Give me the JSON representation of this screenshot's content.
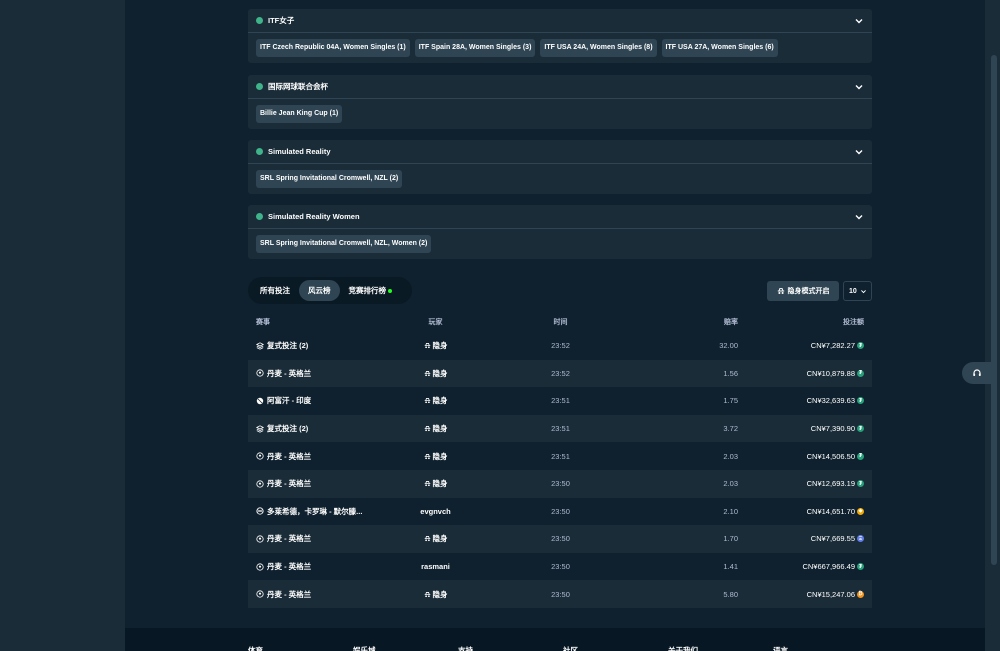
{
  "sections": [
    {
      "title": "ITF女子",
      "chips": [
        "ITF Czech Republic 04A, Women Singles (1)",
        "ITF Spain 28A, Women Singles (3)",
        "ITF USA 24A, Women Singles (8)",
        "ITF USA 27A, Women Singles (6)"
      ]
    },
    {
      "title": "国际网球联合会杯",
      "chips": [
        "Billie Jean King Cup (1)"
      ]
    },
    {
      "title": "Simulated Reality",
      "chips": [
        "SRL Spring Invitational Cromwell, NZL (2)"
      ]
    },
    {
      "title": "Simulated Reality Women",
      "chips": [
        "SRL Spring Invitational Cromwell, NZL, Women (2)"
      ]
    }
  ],
  "tabs": {
    "all_bets": "所有投注",
    "high_rollers": "风云榜",
    "race_leaderboard": "竞赛排行榜"
  },
  "stealth_label": "隐身模式开启",
  "page_size": "10",
  "table": {
    "headers": {
      "event": "赛事",
      "player": "玩家",
      "time": "时间",
      "odds": "赔率",
      "amount": "投注额"
    },
    "rows": [
      {
        "event": "复式投注 (2)",
        "icon": "multi-bet-icon",
        "player": "隐身",
        "hidden": true,
        "time": "23:52",
        "odds": "32.00",
        "amount": "CN¥7,282.27",
        "coin": "tether-coin-icon",
        "coin_color": "#26a17b"
      },
      {
        "event": "丹麦 - 英格兰",
        "icon": "soccer-ball-icon",
        "player": "隐身",
        "hidden": true,
        "time": "23:52",
        "odds": "1.56",
        "amount": "CN¥10,879.88",
        "coin": "tether-coin-icon",
        "coin_color": "#26a17b"
      },
      {
        "event": "阿富汗 - 印度",
        "icon": "cricket-ball-icon",
        "player": "隐身",
        "hidden": true,
        "time": "23:51",
        "odds": "1.75",
        "amount": "CN¥32,639.63",
        "coin": "tether-coin-icon",
        "coin_color": "#26a17b"
      },
      {
        "event": "复式投注 (2)",
        "icon": "multi-bet-icon",
        "player": "隐身",
        "hidden": true,
        "time": "23:51",
        "odds": "3.72",
        "amount": "CN¥7,390.90",
        "coin": "tether-coin-icon",
        "coin_color": "#26a17b"
      },
      {
        "event": "丹麦 - 英格兰",
        "icon": "soccer-ball-icon",
        "player": "隐身",
        "hidden": true,
        "time": "23:51",
        "odds": "2.03",
        "amount": "CN¥14,506.50",
        "coin": "tether-coin-icon",
        "coin_color": "#26a17b"
      },
      {
        "event": "丹麦 - 英格兰",
        "icon": "soccer-ball-icon",
        "player": "隐身",
        "hidden": true,
        "time": "23:50",
        "odds": "2.03",
        "amount": "CN¥12,693.19",
        "coin": "tether-coin-icon",
        "coin_color": "#26a17b"
      },
      {
        "event": "多莱希德，卡罗琳 - 默尔滕...",
        "icon": "tennis-ball-icon",
        "player": "evgnvch",
        "hidden": false,
        "time": "23:50",
        "odds": "2.10",
        "amount": "CN¥14,651.70",
        "coin": "gold-coin-icon",
        "coin_color": "#f2a900"
      },
      {
        "event": "丹麦 - 英格兰",
        "icon": "soccer-ball-icon",
        "player": "隐身",
        "hidden": true,
        "time": "23:50",
        "odds": "1.70",
        "amount": "CN¥7,669.55",
        "coin": "eth-coin-icon",
        "coin_color": "#627eea"
      },
      {
        "event": "丹麦 - 英格兰",
        "icon": "soccer-ball-icon",
        "player": "rasmani",
        "hidden": false,
        "time": "23:50",
        "odds": "1.41",
        "amount": "CN¥667,966.49",
        "coin": "tether-coin-icon",
        "coin_color": "#26a17b"
      },
      {
        "event": "丹麦 - 英格兰",
        "icon": "soccer-ball-icon",
        "player": "隐身",
        "hidden": true,
        "time": "23:50",
        "odds": "5.80",
        "amount": "CN¥15,247.06",
        "coin": "btc-coin-icon",
        "coin_color": "#f7931a"
      }
    ]
  },
  "footer": {
    "links": [
      "体育",
      "娱乐城",
      "支持",
      "社区",
      "关于我们",
      "语言"
    ]
  },
  "colors": {
    "accent_green": "#1fff20",
    "panel": "#1a2c38",
    "background": "#0f212e"
  }
}
